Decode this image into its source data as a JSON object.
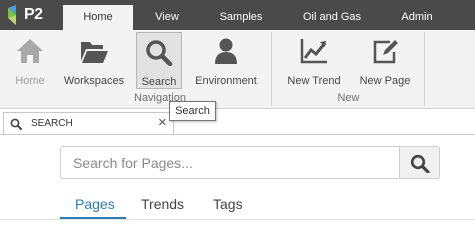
{
  "app": {
    "logo_text": "P2"
  },
  "menu": {
    "tabs": [
      {
        "label": "Home",
        "active": true
      },
      {
        "label": "View"
      },
      {
        "label": "Samples"
      },
      {
        "label": "Oil and Gas"
      },
      {
        "label": "Admin"
      }
    ]
  },
  "ribbon": {
    "navigation": {
      "label": "Navigation",
      "buttons": [
        {
          "label": "Home",
          "icon": "home-icon",
          "disabled": true
        },
        {
          "label": "Workspaces",
          "icon": "folder-open-icon"
        },
        {
          "label": "Search",
          "icon": "search-icon",
          "selected": true
        },
        {
          "label": "Environment",
          "icon": "user-icon"
        }
      ]
    },
    "new": {
      "label": "New",
      "buttons": [
        {
          "label": "New Trend",
          "icon": "trend-chart-icon"
        },
        {
          "label": "New Page",
          "icon": "edit-page-icon"
        }
      ]
    }
  },
  "tooltip": {
    "text": "Search"
  },
  "document_tab": {
    "title": "SEARCH",
    "close_glyph": "×",
    "icon": "search-icon"
  },
  "search": {
    "placeholder": "Search for Pages...",
    "value": ""
  },
  "subtabs": [
    {
      "label": "Pages",
      "active": true
    },
    {
      "label": "Trends"
    },
    {
      "label": "Tags"
    }
  ],
  "colors": {
    "topbar": "#4a4a4a",
    "ribbon": "#f3f3f3",
    "accent": "#2d7bb6",
    "logo_blue": "#4aa3df",
    "logo_green": "#7dc242"
  }
}
